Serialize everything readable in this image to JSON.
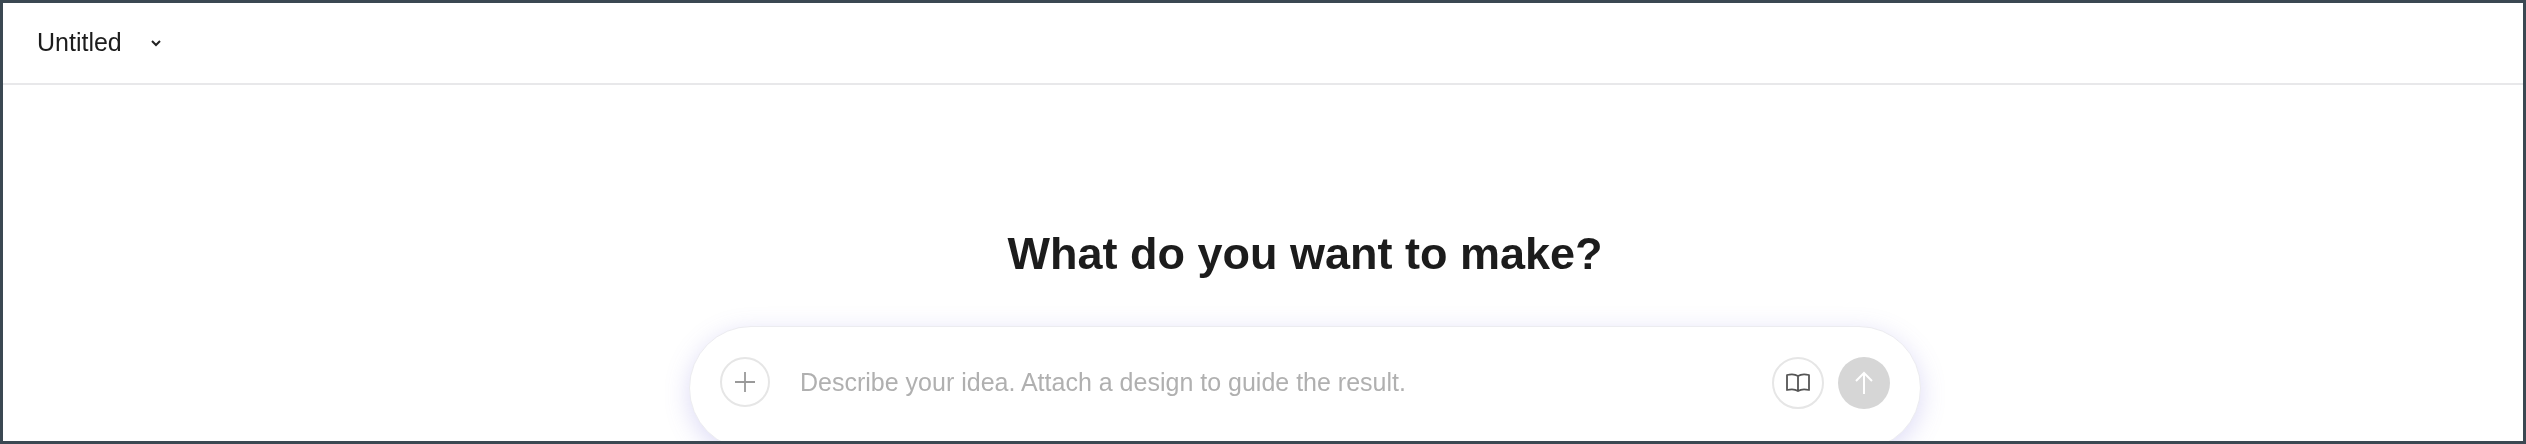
{
  "header": {
    "title": "Untitled"
  },
  "heading": "What do you want to make?",
  "prompt": {
    "placeholder": "Describe your idea. Attach a design to guide the result.",
    "send_disabled": true
  }
}
